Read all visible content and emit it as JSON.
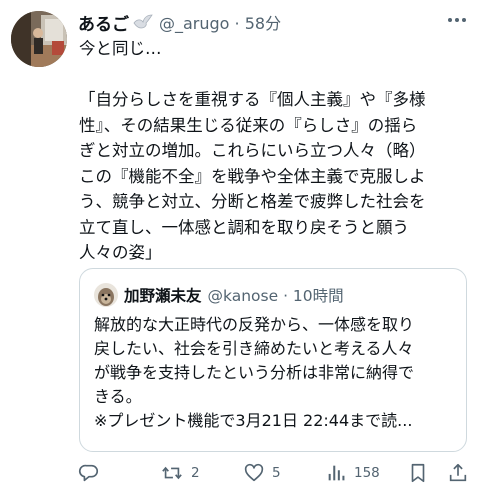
{
  "tweet": {
    "author_name": "あるご",
    "author_meta": "@_arugo · 58分",
    "text": "今と同じ…\n\n「自分らしさを重視する『個人主義』や『多様\n性』、その結果生じる従来の『らしさ』の揺ら\nぎと対立の増加。これらにいら立つ人々（略）\nこの『機能不全』を戦争や全体主義で克服しよ\nう、競争と対立、分断と格差で疲弊した社会を\n立て直し、一体感と調和を取り戻そうと願う\n人々の姿」"
  },
  "quote": {
    "author_name": "加野瀬未友",
    "author_meta": "@kanose · 10時間",
    "text": "解放的な大正時代の反発から、一体感を取り\n戻したい、社会を引き締めたいと考える人々\nが戦争を支持したという分析は非常に納得で\nきる。\n※プレゼント機能で3月21日 22:44まで読..."
  },
  "actions": {
    "reply_icon": "reply-icon",
    "retweet_count": "2",
    "like_count": "5",
    "views_count": "158",
    "bookmark_icon": "bookmark-icon",
    "share_icon": "share-icon"
  },
  "colors": {
    "text": "#0f1419",
    "secondary": "#536471",
    "border": "#cfd9de",
    "background": "#ffffff"
  }
}
